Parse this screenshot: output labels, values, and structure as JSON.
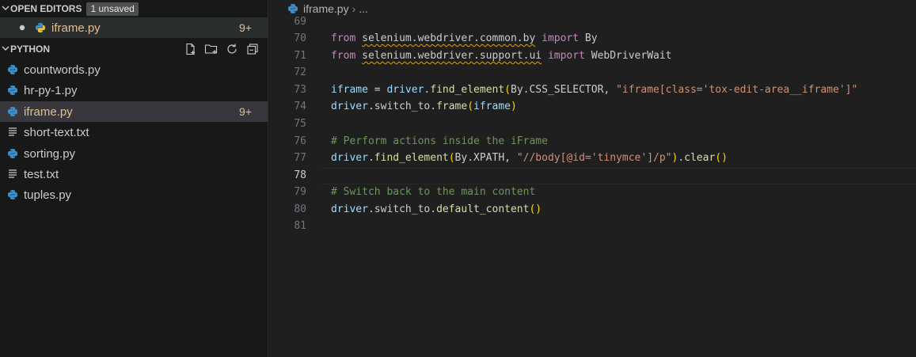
{
  "open_editors": {
    "title": "OPEN EDITORS",
    "badge": "1 unsaved",
    "items": [
      {
        "label": "iframe.py",
        "count": "9+",
        "icon": "python-icon"
      }
    ]
  },
  "explorer": {
    "title": "PYTHON",
    "actions": [
      "new-file-icon",
      "new-folder-icon",
      "refresh-icon",
      "collapse-all-icon"
    ],
    "files": [
      {
        "label": "countwords.py",
        "icon": "python-icon"
      },
      {
        "label": "hr-py-1.py",
        "icon": "python-icon"
      },
      {
        "label": "iframe.py",
        "icon": "python-icon",
        "count": "9+",
        "active": true
      },
      {
        "label": "short-text.txt",
        "icon": "text-file-icon"
      },
      {
        "label": "sorting.py",
        "icon": "python-icon"
      },
      {
        "label": "test.txt",
        "icon": "text-file-icon"
      },
      {
        "label": "tuples.py",
        "icon": "python-icon"
      }
    ]
  },
  "editor": {
    "breadcrumb": {
      "file": "iframe.py",
      "separator": "›",
      "rest": "..."
    },
    "current_line": "78",
    "line_numbers": [
      "69",
      "70",
      "71",
      "72",
      "73",
      "74",
      "75",
      "76",
      "77",
      "78",
      "79",
      "80",
      "81"
    ],
    "code": {
      "l70": {
        "k1": "from",
        "mod": "selenium.webdriver.common.by",
        "k2": "import",
        "name": "By"
      },
      "l71": {
        "k1": "from",
        "mod": "selenium.webdriver.support.ui",
        "k2": "import",
        "name": "WebDriverWait"
      },
      "l73": {
        "v": "iframe",
        "eq": " = ",
        "obj": "driver",
        "dot": ".",
        "fn": "find_element",
        "p1": "(",
        "args": "By.CSS_SELECTOR, ",
        "str": "\"iframe[class='tox-edit-area__iframe']\""
      },
      "l74": {
        "obj": "driver",
        "mid": ".switch_to.",
        "fn": "frame",
        "p1": "(",
        "arg": "iframe",
        "p2": ")"
      },
      "l76": {
        "comment": "# Perform actions inside the iFrame"
      },
      "l77": {
        "obj": "driver",
        "dot": ".",
        "fn": "find_element",
        "p1": "(",
        "args": "By.XPATH, ",
        "str": "\"//body[@id='tinymce']/p\"",
        "p2": ")",
        "dot2": ".",
        "fn2": "clear",
        "p3": "()"
      },
      "l79": {
        "comment": "# Switch back to the main content"
      },
      "l80": {
        "obj": "driver",
        "mid": ".switch_to.",
        "fn": "default_content",
        "p1": "()"
      }
    }
  },
  "colors": {
    "sidebar_bg": "#181818",
    "editor_bg": "#1f1f1f",
    "modified": "#e2c08d",
    "keyword": "#c586c0",
    "string": "#ce9178",
    "comment": "#6a9955",
    "function": "#dcdcaa",
    "variable": "#9cdcfe"
  }
}
